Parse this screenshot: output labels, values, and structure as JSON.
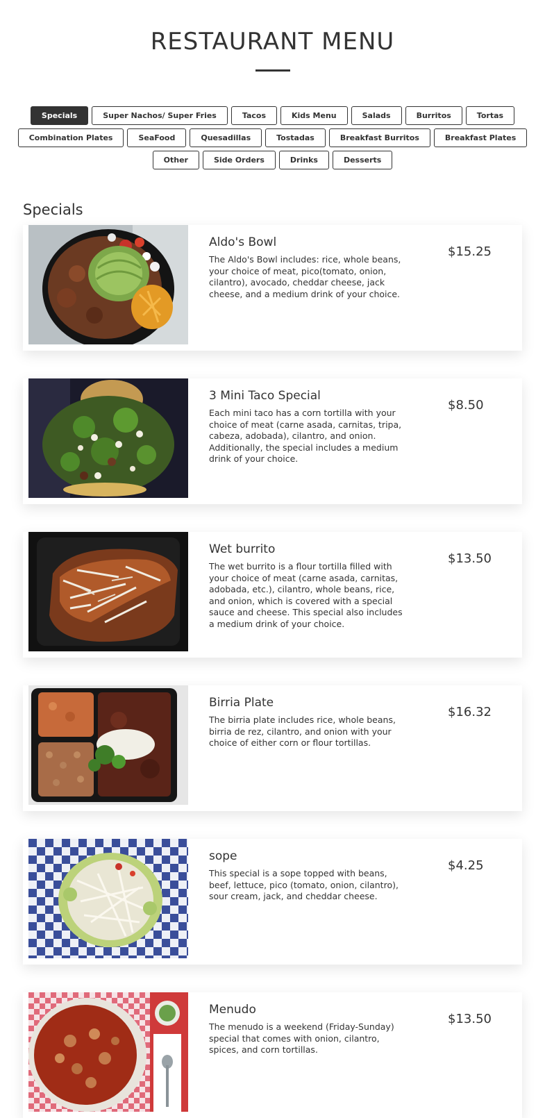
{
  "page": {
    "title": "RESTAURANT MENU"
  },
  "categories": {
    "active": "Specials",
    "rows": [
      [
        "Specials",
        "Super Nachos/ Super Fries",
        "Tacos",
        "Kids Menu",
        "Salads",
        "Burritos",
        "Tortas"
      ],
      [
        "Combination Plates",
        "SeaFood",
        "Quesadillas",
        "Tostadas",
        "Breakfast Burritos",
        "Breakfast Plates"
      ],
      [
        "Other",
        "Side Orders",
        "Drinks",
        "Desserts"
      ]
    ]
  },
  "section": {
    "title": "Specials"
  },
  "items": [
    {
      "name": "Aldo's Bowl",
      "description": "The Aldo's Bowl includes: rice, whole beans, your choice of meat, pico(tomato, onion, cilantro), avocado, cheddar cheese, jack cheese, and a medium drink of your choice.",
      "price": "$15.25",
      "image": "bowl-photo"
    },
    {
      "name": "3 Mini Taco Special",
      "description": "Each mini taco has a corn tortilla with your choice of meat (carne asada, carnitas, tripa, cabeza, adobada), cilantro, and onion. Additionally, the special includes a medium drink of your choice.",
      "price": "$8.50",
      "image": "tacos-photo"
    },
    {
      "name": "Wet burrito",
      "description": "The wet burrito is a flour tortilla filled with your choice of meat (carne asada, carnitas, adobada, etc.), cilantro, whole beans, rice, and onion, which is covered with a special sauce and cheese. This special also includes a medium drink of your choice.",
      "price": "$13.50",
      "image": "burrito-photo"
    },
    {
      "name": "Birria Plate",
      "description": "The birria plate includes rice, whole beans, birria de rez, cilantro, and onion with your choice of either corn or flour tortillas.",
      "price": "$16.32",
      "image": "birria-photo"
    },
    {
      "name": "sope",
      "description": "This special is a sope topped with beans, beef, lettuce, pico (tomato, onion, cilantro), sour cream, jack, and cheddar cheese.",
      "price": "$4.25",
      "image": "sope-photo"
    },
    {
      "name": "Menudo",
      "description": "The menudo is a weekend (Friday-Sunday) special that comes with onion, cilantro, spices, and corn tortillas.",
      "price": "$13.50",
      "image": "menudo-photo"
    }
  ]
}
